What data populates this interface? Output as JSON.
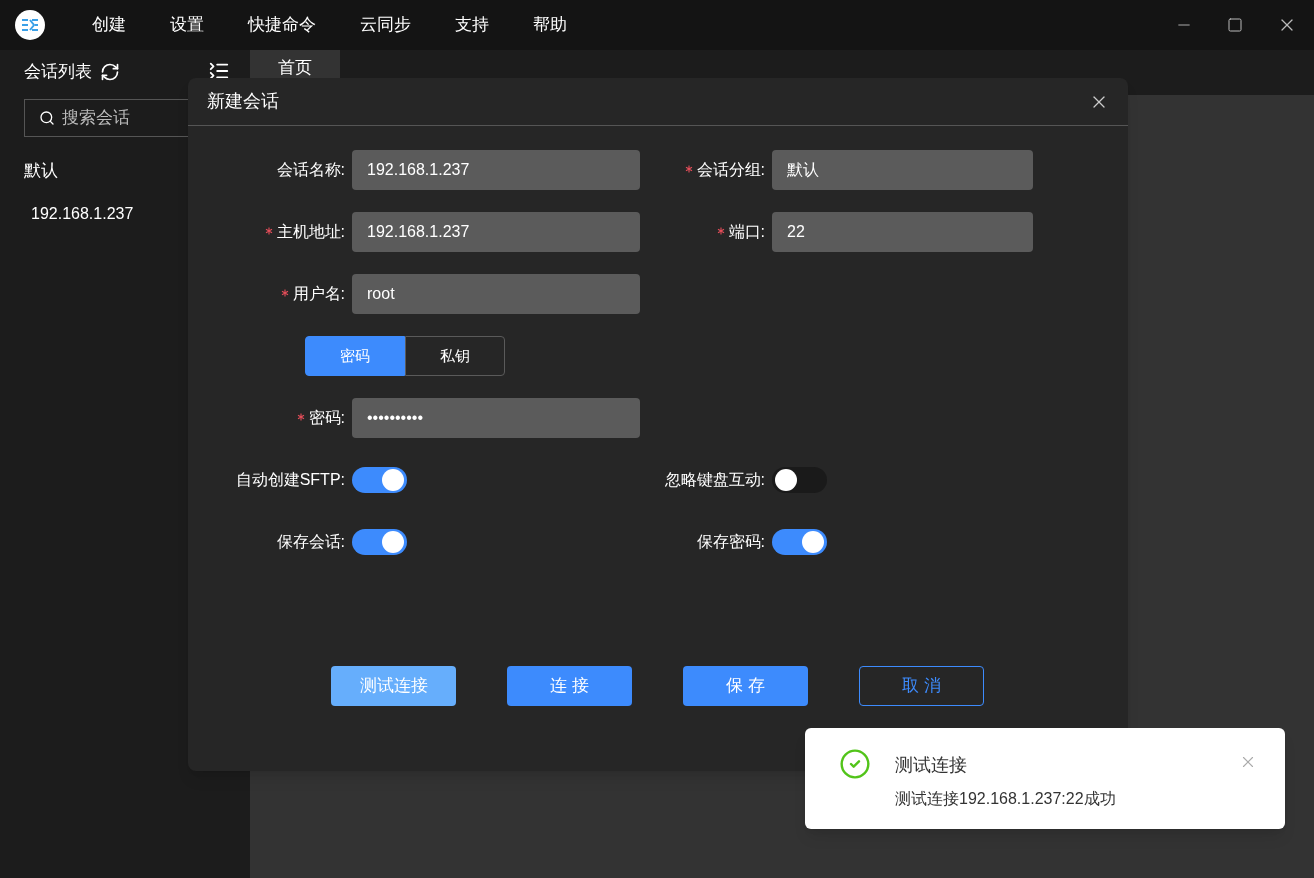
{
  "menu": [
    "创建",
    "设置",
    "快捷命令",
    "云同步",
    "支持",
    "帮助"
  ],
  "sidebar": {
    "title": "会话列表",
    "search": {
      "placeholder": "搜索会话"
    },
    "groups": [
      {
        "name": "默认",
        "sessions": [
          "192.168.1.237"
        ]
      }
    ]
  },
  "tabs": [
    {
      "label": "首页",
      "selected": true
    }
  ],
  "dialog": {
    "title": "新建会话",
    "rows": [
      [
        {
          "kind": "input",
          "label": "会话名称:",
          "required": false,
          "value": "192.168.1.237"
        },
        {
          "kind": "input",
          "label": "会话分组:",
          "required": true,
          "value": "默认"
        }
      ],
      [
        {
          "kind": "input",
          "label": "主机地址:",
          "required": true,
          "value": "192.168.1.237"
        },
        {
          "kind": "input",
          "label": "端口:",
          "required": true,
          "value": "22"
        }
      ],
      [
        {
          "kind": "input",
          "label": "用户名:",
          "required": true,
          "value": "root"
        }
      ],
      [
        {
          "kind": "segmented",
          "options": [
            {
              "label": "密码",
              "selected": true
            },
            {
              "label": "私钥",
              "selected": false
            }
          ]
        }
      ],
      [
        {
          "kind": "password",
          "label": "密码:",
          "required": true,
          "value": "••••••••••"
        }
      ],
      [
        {
          "kind": "switch",
          "label": "自动创建SFTP:",
          "on": true
        },
        {
          "kind": "switch",
          "label": "忽略键盘互动:",
          "on": false
        }
      ],
      [
        {
          "kind": "switch",
          "label": "保存会话:",
          "on": true
        },
        {
          "kind": "switch",
          "label": "保存密码:",
          "on": true
        }
      ]
    ],
    "buttons": [
      {
        "label": "测试连接",
        "kind": "light"
      },
      {
        "label": "连 接",
        "kind": "primary"
      },
      {
        "label": "保 存",
        "kind": "primary"
      },
      {
        "label": "取 消",
        "kind": "outline"
      }
    ]
  },
  "toast": {
    "kind": "success",
    "title": "测试连接",
    "message": "测试连接192.168.1.237:22成功"
  }
}
